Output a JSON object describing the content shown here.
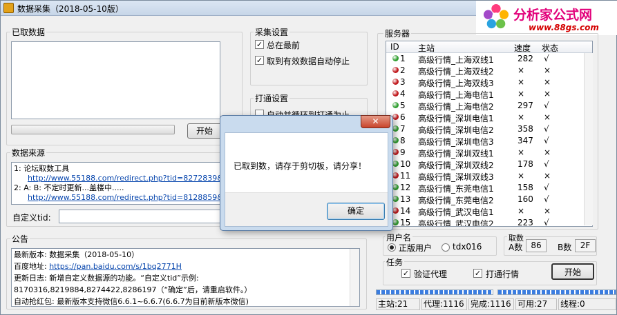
{
  "window": {
    "title": "数据采集（2018-05-10版）"
  },
  "logo": {
    "main": "分析家公式网",
    "sub": "www.88gs.com"
  },
  "fetched": {
    "label": "已取数据",
    "start_label": "开始"
  },
  "collect_settings": {
    "label": "采集设置",
    "always_on_top": {
      "label": "总在最前",
      "checked": true
    },
    "auto_stop": {
      "label": "取到有效数据自动停止",
      "checked": true
    }
  },
  "connect_settings": {
    "label": "打通设置",
    "loop_label": "自动并循环到打通为止"
  },
  "source": {
    "label": "数据来源",
    "lines": [
      {
        "text": "1: 论坛取数工具",
        "url": "http://www.55188.com/redirect.php?tid=8272839&"
      },
      {
        "text": "2: A: B: 不定时更新...盖楼中.....",
        "url": "http://www.55188.com/redirect.php?tid=8128859&"
      }
    ],
    "custom_tid_label": "自定义tid:",
    "custom_tid_value": ""
  },
  "notice": {
    "label": "公告",
    "lines": [
      {
        "text": "最新版本: 数据采集（2018-05-10）"
      },
      {
        "text": "百度地址: ",
        "link": "https://pan.baidu.com/s/1bq2771H"
      },
      {
        "text": "更新日志: 新增自定义数据源的功能。“自定义tid”示例:"
      },
      {
        "text": "8170316,8219884,8274422,8286197（“确定”后，请重启软件。）"
      },
      {
        "text": "自动抢红包: 最新版本支持微信6.6.1~6.6.7(6.6.7为目前新版本微信)"
      }
    ]
  },
  "servers": {
    "label": "服务器",
    "headers": [
      "ID",
      "主站",
      "速度",
      "状态"
    ],
    "rows": [
      {
        "id": "1",
        "name": "高级行情_上海双线1",
        "speed": "282",
        "status": "√",
        "color": "#2e9e2e"
      },
      {
        "id": "2",
        "name": "高级行情_上海双线2",
        "speed": "×",
        "status": "×",
        "color": "#c0171b"
      },
      {
        "id": "3",
        "name": "高级行情_上海双线3",
        "speed": "×",
        "status": "×",
        "color": "#c0171b"
      },
      {
        "id": "4",
        "name": "高级行情_上海电信1",
        "speed": "×",
        "status": "×",
        "color": "#c0171b"
      },
      {
        "id": "5",
        "name": "高级行情_上海电信2",
        "speed": "297",
        "status": "√",
        "color": "#2e9e2e"
      },
      {
        "id": "6",
        "name": "高级行情_深圳电信1",
        "speed": "×",
        "status": "×",
        "color": "#c0171b"
      },
      {
        "id": "7",
        "name": "高级行情_深圳电信2",
        "speed": "358",
        "status": "√",
        "color": "#2e9e2e"
      },
      {
        "id": "8",
        "name": "高级行情_深圳电信3",
        "speed": "347",
        "status": "√",
        "color": "#2e9e2e"
      },
      {
        "id": "9",
        "name": "高级行情_深圳双线1",
        "speed": "×",
        "status": "×",
        "color": "#c0171b"
      },
      {
        "id": "10",
        "name": "高级行情_深圳双线2",
        "speed": "178",
        "status": "√",
        "color": "#2e9e2e"
      },
      {
        "id": "11",
        "name": "高级行情_深圳双线3",
        "speed": "×",
        "status": "×",
        "color": "#c0171b"
      },
      {
        "id": "12",
        "name": "高级行情_东莞电信1",
        "speed": "158",
        "status": "√",
        "color": "#2e9e2e"
      },
      {
        "id": "13",
        "name": "高级行情_东莞电信2",
        "speed": "160",
        "status": "√",
        "color": "#2e9e2e"
      },
      {
        "id": "14",
        "name": "高级行情_武汉电信1",
        "speed": "×",
        "status": "×",
        "color": "#c0171b"
      },
      {
        "id": "15",
        "name": "高级行情_武汉电信2",
        "speed": "223",
        "status": "√",
        "color": "#2e9e2e"
      }
    ]
  },
  "user": {
    "label": "用户名",
    "opt1": "正版用户",
    "opt2": "tdx016"
  },
  "fetch_count": {
    "label_top": "取数",
    "a_label": "A数",
    "a_value": "86",
    "b_label": "B数",
    "b_value": "2F"
  },
  "task": {
    "label": "任务",
    "verify_proxy": {
      "label": "验证代理",
      "checked": true
    },
    "connect_quotes": {
      "label": "打通行情",
      "checked": true
    },
    "start_label": "开始"
  },
  "statusbar": {
    "main": "主站:21",
    "proxy": "代理:1116",
    "done": "完成:1116",
    "usable": "可用:27",
    "threads": "线程:0"
  },
  "dialog": {
    "message": "已取到数，请存于剪切板，请分享！",
    "ok_label": "确定",
    "close_glyph": "✕"
  },
  "colors": {
    "green": "#2e9e2e",
    "red": "#c0171b",
    "progress_blue": "#3b7de0"
  }
}
